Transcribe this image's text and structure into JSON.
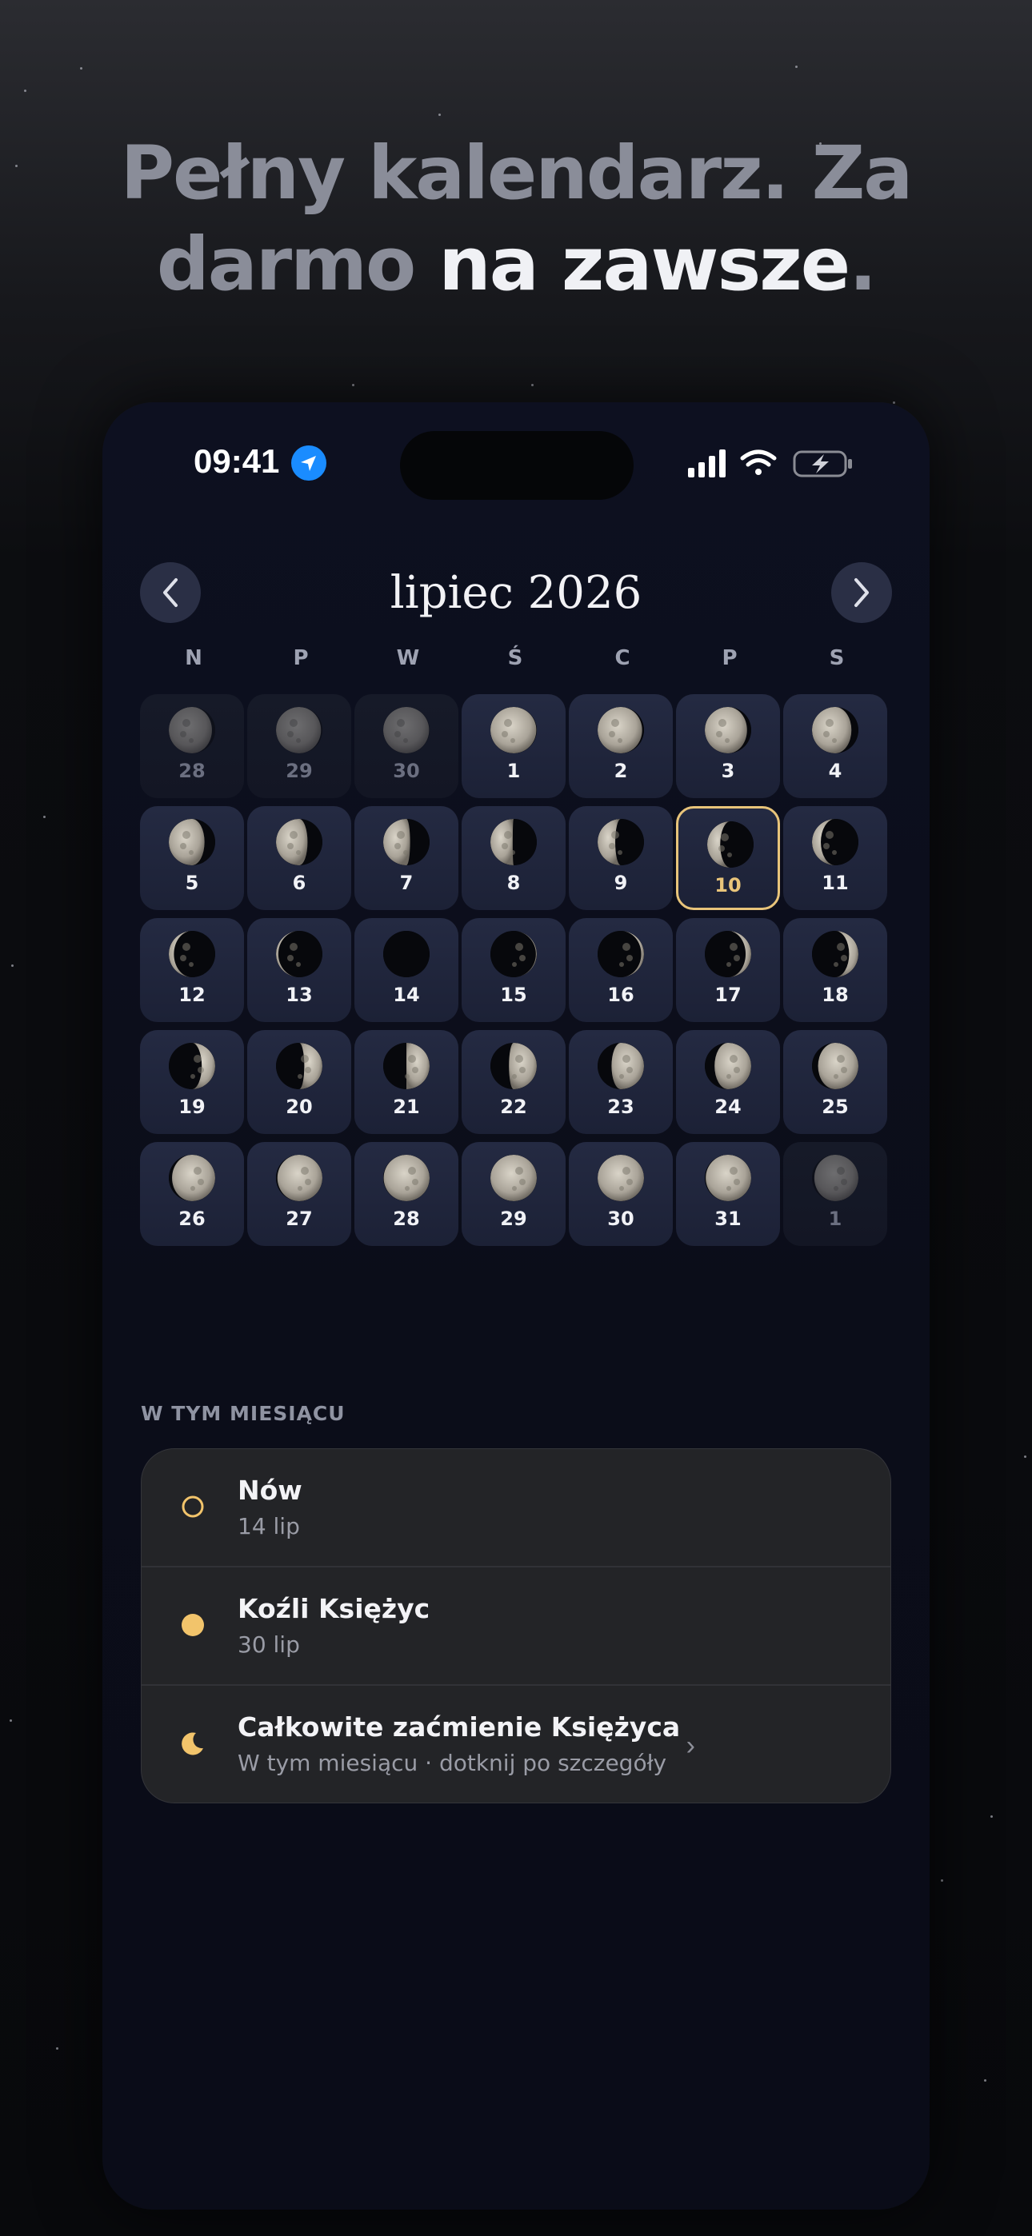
{
  "headline": {
    "line1": "Pełny kalendarz. Za",
    "line2_dim": "darmo",
    "line2_bright": "na zawsze",
    "line2_end": "."
  },
  "status_bar": {
    "time": "09:41"
  },
  "calendar": {
    "month_title": "lipiec 2026",
    "prev_icon": "chevron-left-icon",
    "next_icon": "chevron-right-icon",
    "weekdays": [
      "N",
      "P",
      "W",
      "Ś",
      "C",
      "P",
      "S"
    ],
    "days": [
      {
        "label": "28",
        "other": true,
        "phase": 0.93,
        "today": false
      },
      {
        "label": "29",
        "other": true,
        "phase": 0.97,
        "today": false
      },
      {
        "label": "30",
        "other": true,
        "phase": 0.99,
        "today": false
      },
      {
        "label": "1",
        "other": false,
        "phase": 0.99,
        "today": false
      },
      {
        "label": "2",
        "other": false,
        "phase": 0.96,
        "today": false
      },
      {
        "label": "3",
        "other": false,
        "phase": 0.91,
        "today": false
      },
      {
        "label": "4",
        "other": false,
        "phase": 0.85,
        "today": false
      },
      {
        "label": "5",
        "other": false,
        "phase": 0.77,
        "today": false
      },
      {
        "label": "6",
        "other": false,
        "phase": 0.68,
        "today": false
      },
      {
        "label": "7",
        "other": false,
        "phase": 0.58,
        "today": false
      },
      {
        "label": "8",
        "other": false,
        "phase": 0.48,
        "today": false
      },
      {
        "label": "9",
        "other": false,
        "phase": 0.38,
        "today": false
      },
      {
        "label": "10",
        "other": false,
        "phase": 0.28,
        "today": true
      },
      {
        "label": "11",
        "other": false,
        "phase": 0.19,
        "today": false
      },
      {
        "label": "12",
        "other": false,
        "phase": 0.11,
        "today": false
      },
      {
        "label": "13",
        "other": false,
        "phase": 0.05,
        "today": false
      },
      {
        "label": "14",
        "other": false,
        "phase": 0.0,
        "today": false
      },
      {
        "label": "15",
        "other": false,
        "phase": 0.02,
        "today": false
      },
      {
        "label": "16",
        "other": false,
        "phase": 0.06,
        "today": false
      },
      {
        "label": "17",
        "other": false,
        "phase": 0.12,
        "today": false
      },
      {
        "label": "18",
        "other": false,
        "phase": 0.2,
        "today": false
      },
      {
        "label": "19",
        "other": false,
        "phase": 0.29,
        "today": false
      },
      {
        "label": "20",
        "other": false,
        "phase": 0.39,
        "today": false
      },
      {
        "label": "21",
        "other": false,
        "phase": 0.5,
        "today": false
      },
      {
        "label": "22",
        "other": false,
        "phase": 0.6,
        "today": false
      },
      {
        "label": "23",
        "other": false,
        "phase": 0.7,
        "today": false
      },
      {
        "label": "24",
        "other": false,
        "phase": 0.79,
        "today": false
      },
      {
        "label": "25",
        "other": false,
        "phase": 0.87,
        "today": false
      },
      {
        "label": "26",
        "other": false,
        "phase": 0.93,
        "today": false
      },
      {
        "label": "27",
        "other": false,
        "phase": 0.97,
        "today": false
      },
      {
        "label": "28",
        "other": false,
        "phase": 0.99,
        "today": false
      },
      {
        "label": "29",
        "other": false,
        "phase": 1.0,
        "today": false
      },
      {
        "label": "30",
        "other": false,
        "phase": 1.0,
        "today": false
      },
      {
        "label": "31",
        "other": false,
        "phase": 0.98,
        "today": false
      },
      {
        "label": "1",
        "other": true,
        "phase": 0.95,
        "today": false
      }
    ]
  },
  "this_month": {
    "label": "W TYM MIESIĄCU",
    "events": [
      {
        "title": "Nów",
        "subtitle": "14 lip",
        "icon": "new-moon-ring-icon",
        "color": "#f2c46b"
      },
      {
        "title": "Koźli Księżyc",
        "subtitle": "30 lip",
        "icon": "full-moon-dot-icon",
        "color": "#f2c46b"
      },
      {
        "title": "Całkowite zaćmienie Księżyca",
        "subtitle": "W tym miesiącu · dotknij po szczegóły",
        "icon": "crescent-moon-icon",
        "color": "#f2c46b",
        "chevron": "›"
      }
    ]
  }
}
